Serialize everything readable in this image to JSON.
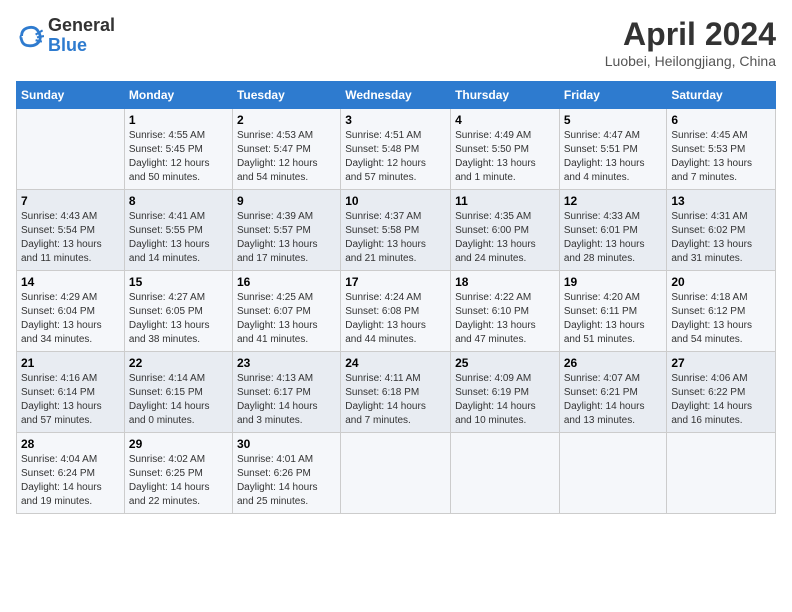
{
  "logo": {
    "general": "General",
    "blue": "Blue"
  },
  "title": "April 2024",
  "location": "Luobei, Heilongjiang, China",
  "headers": [
    "Sunday",
    "Monday",
    "Tuesday",
    "Wednesday",
    "Thursday",
    "Friday",
    "Saturday"
  ],
  "weeks": [
    [
      {
        "day": "",
        "info": ""
      },
      {
        "day": "1",
        "info": "Sunrise: 4:55 AM\nSunset: 5:45 PM\nDaylight: 12 hours\nand 50 minutes."
      },
      {
        "day": "2",
        "info": "Sunrise: 4:53 AM\nSunset: 5:47 PM\nDaylight: 12 hours\nand 54 minutes."
      },
      {
        "day": "3",
        "info": "Sunrise: 4:51 AM\nSunset: 5:48 PM\nDaylight: 12 hours\nand 57 minutes."
      },
      {
        "day": "4",
        "info": "Sunrise: 4:49 AM\nSunset: 5:50 PM\nDaylight: 13 hours\nand 1 minute."
      },
      {
        "day": "5",
        "info": "Sunrise: 4:47 AM\nSunset: 5:51 PM\nDaylight: 13 hours\nand 4 minutes."
      },
      {
        "day": "6",
        "info": "Sunrise: 4:45 AM\nSunset: 5:53 PM\nDaylight: 13 hours\nand 7 minutes."
      }
    ],
    [
      {
        "day": "7",
        "info": "Sunrise: 4:43 AM\nSunset: 5:54 PM\nDaylight: 13 hours\nand 11 minutes."
      },
      {
        "day": "8",
        "info": "Sunrise: 4:41 AM\nSunset: 5:55 PM\nDaylight: 13 hours\nand 14 minutes."
      },
      {
        "day": "9",
        "info": "Sunrise: 4:39 AM\nSunset: 5:57 PM\nDaylight: 13 hours\nand 17 minutes."
      },
      {
        "day": "10",
        "info": "Sunrise: 4:37 AM\nSunset: 5:58 PM\nDaylight: 13 hours\nand 21 minutes."
      },
      {
        "day": "11",
        "info": "Sunrise: 4:35 AM\nSunset: 6:00 PM\nDaylight: 13 hours\nand 24 minutes."
      },
      {
        "day": "12",
        "info": "Sunrise: 4:33 AM\nSunset: 6:01 PM\nDaylight: 13 hours\nand 28 minutes."
      },
      {
        "day": "13",
        "info": "Sunrise: 4:31 AM\nSunset: 6:02 PM\nDaylight: 13 hours\nand 31 minutes."
      }
    ],
    [
      {
        "day": "14",
        "info": "Sunrise: 4:29 AM\nSunset: 6:04 PM\nDaylight: 13 hours\nand 34 minutes."
      },
      {
        "day": "15",
        "info": "Sunrise: 4:27 AM\nSunset: 6:05 PM\nDaylight: 13 hours\nand 38 minutes."
      },
      {
        "day": "16",
        "info": "Sunrise: 4:25 AM\nSunset: 6:07 PM\nDaylight: 13 hours\nand 41 minutes."
      },
      {
        "day": "17",
        "info": "Sunrise: 4:24 AM\nSunset: 6:08 PM\nDaylight: 13 hours\nand 44 minutes."
      },
      {
        "day": "18",
        "info": "Sunrise: 4:22 AM\nSunset: 6:10 PM\nDaylight: 13 hours\nand 47 minutes."
      },
      {
        "day": "19",
        "info": "Sunrise: 4:20 AM\nSunset: 6:11 PM\nDaylight: 13 hours\nand 51 minutes."
      },
      {
        "day": "20",
        "info": "Sunrise: 4:18 AM\nSunset: 6:12 PM\nDaylight: 13 hours\nand 54 minutes."
      }
    ],
    [
      {
        "day": "21",
        "info": "Sunrise: 4:16 AM\nSunset: 6:14 PM\nDaylight: 13 hours\nand 57 minutes."
      },
      {
        "day": "22",
        "info": "Sunrise: 4:14 AM\nSunset: 6:15 PM\nDaylight: 14 hours\nand 0 minutes."
      },
      {
        "day": "23",
        "info": "Sunrise: 4:13 AM\nSunset: 6:17 PM\nDaylight: 14 hours\nand 3 minutes."
      },
      {
        "day": "24",
        "info": "Sunrise: 4:11 AM\nSunset: 6:18 PM\nDaylight: 14 hours\nand 7 minutes."
      },
      {
        "day": "25",
        "info": "Sunrise: 4:09 AM\nSunset: 6:19 PM\nDaylight: 14 hours\nand 10 minutes."
      },
      {
        "day": "26",
        "info": "Sunrise: 4:07 AM\nSunset: 6:21 PM\nDaylight: 14 hours\nand 13 minutes."
      },
      {
        "day": "27",
        "info": "Sunrise: 4:06 AM\nSunset: 6:22 PM\nDaylight: 14 hours\nand 16 minutes."
      }
    ],
    [
      {
        "day": "28",
        "info": "Sunrise: 4:04 AM\nSunset: 6:24 PM\nDaylight: 14 hours\nand 19 minutes."
      },
      {
        "day": "29",
        "info": "Sunrise: 4:02 AM\nSunset: 6:25 PM\nDaylight: 14 hours\nand 22 minutes."
      },
      {
        "day": "30",
        "info": "Sunrise: 4:01 AM\nSunset: 6:26 PM\nDaylight: 14 hours\nand 25 minutes."
      },
      {
        "day": "",
        "info": ""
      },
      {
        "day": "",
        "info": ""
      },
      {
        "day": "",
        "info": ""
      },
      {
        "day": "",
        "info": ""
      }
    ]
  ]
}
